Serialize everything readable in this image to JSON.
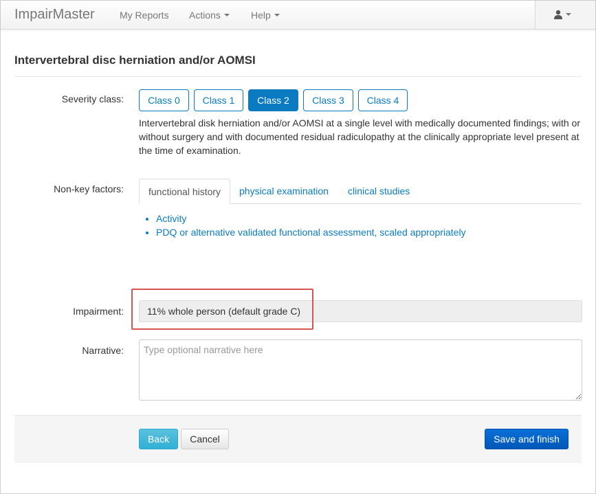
{
  "navbar": {
    "brand": "ImpairMaster",
    "items": [
      {
        "label": "My Reports"
      },
      {
        "label": "Actions"
      },
      {
        "label": "Help"
      }
    ],
    "user_icon": "user-icon"
  },
  "page": {
    "title": "Intervertebral disc herniation and/or AOMSI"
  },
  "severity": {
    "label": "Severity class:",
    "classes": [
      "Class 0",
      "Class 1",
      "Class 2",
      "Class 3",
      "Class 4"
    ],
    "selected": "Class 2",
    "description": "Intervertebral disk herniation and/or AOMSI at a single level with medically documented findings; with or without surgery and with documented residual radiculopathy at the clinically appropriate level present at the time of examination."
  },
  "nonkey": {
    "label": "Non-key factors:",
    "tabs": [
      "functional history",
      "physical examination",
      "clinical studies"
    ],
    "active_tab": "functional history",
    "items": [
      "Activity",
      "PDQ or alternative validated functional assessment, scaled appropriately"
    ]
  },
  "impairment": {
    "label": "Impairment:",
    "value": "11% whole person (default grade C)"
  },
  "narrative": {
    "label": "Narrative:",
    "placeholder": "Type optional narrative here"
  },
  "footer": {
    "back_label": "Back",
    "cancel_label": "Cancel",
    "save_label": "Save and finish"
  },
  "colors": {
    "accent": "#0a7bc0",
    "back_button": "#5bc0de",
    "save_button": "#0a6fd8",
    "highlight": "#d9534f"
  }
}
